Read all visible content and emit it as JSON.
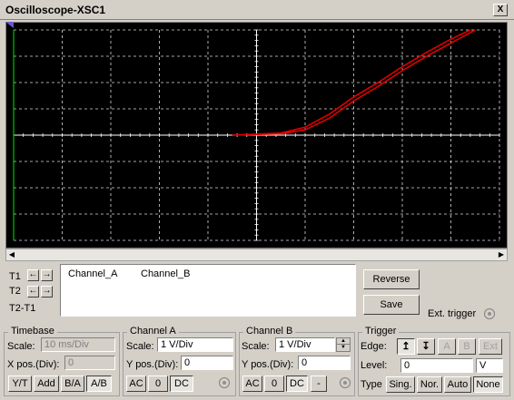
{
  "window": {
    "title": "Oscilloscope-XSC1",
    "close": "X"
  },
  "cursors": {
    "t1_label": "T1",
    "t2_label": "T2",
    "t2t1_label": "T2-T1",
    "left_arrow": "←",
    "right_arrow": "→",
    "channel_a_header": "Channel_A",
    "channel_b_header": "Channel_B"
  },
  "buttons": {
    "reverse": "Reverse",
    "save": "Save",
    "ext_trigger": "Ext. trigger"
  },
  "timebase": {
    "title": "Timebase",
    "scale_label": "Scale:",
    "scale_value": "10 ms/Div",
    "xpos_label": "X pos.(Div):",
    "xpos_value": "0",
    "modes": [
      "Y/T",
      "Add",
      "B/A",
      "A/B"
    ]
  },
  "channel_a": {
    "title": "Channel A",
    "scale_label": "Scale:",
    "scale_value": "1  V/Div",
    "ypos_label": "Y pos.(Div):",
    "ypos_value": "0",
    "couplings": [
      "AC",
      "0",
      "DC"
    ]
  },
  "channel_b": {
    "title": "Channel B",
    "scale_label": "Scale:",
    "scale_value": "1  V/Div",
    "ypos_label": "Y pos.(Div):",
    "ypos_value": "0",
    "couplings": [
      "AC",
      "0",
      "DC",
      "-"
    ]
  },
  "trigger": {
    "title": "Trigger",
    "edge_label": "Edge:",
    "edge_rise": "↥",
    "edge_fall": "↧",
    "sources": [
      "A",
      "B",
      "Ext"
    ],
    "level_label": "Level:",
    "level_value": "0",
    "level_unit": "V",
    "type_label": "Type",
    "types": [
      "Sing.",
      "Nor.",
      "Auto",
      "None"
    ]
  },
  "colors": {
    "trace": "#e00000",
    "grid": "#ffffff",
    "screen_bg": "#000000",
    "cursor_line": "#00c000"
  },
  "chart_data": {
    "type": "line",
    "title": "",
    "xlabel": "",
    "ylabel": "",
    "xlim": [
      -5,
      5
    ],
    "ylim": [
      -4,
      4
    ],
    "divisions_x": 10,
    "divisions_y": 8,
    "grid": true,
    "series": [
      {
        "x": [
          -0.5,
          0.5,
          1.0,
          1.5,
          2.0,
          2.5,
          3.0,
          3.5,
          4.0,
          4.5
        ],
        "y": [
          0.0,
          0.05,
          0.2,
          0.65,
          1.3,
          1.85,
          2.45,
          3.0,
          3.5,
          4.0
        ]
      },
      {
        "x": [
          -0.5,
          0.5,
          1.0,
          1.5,
          2.0,
          2.5,
          3.0,
          3.5,
          4.0,
          4.4
        ],
        "y": [
          0.0,
          0.08,
          0.3,
          0.8,
          1.45,
          2.0,
          2.6,
          3.15,
          3.65,
          4.0
        ]
      }
    ]
  }
}
